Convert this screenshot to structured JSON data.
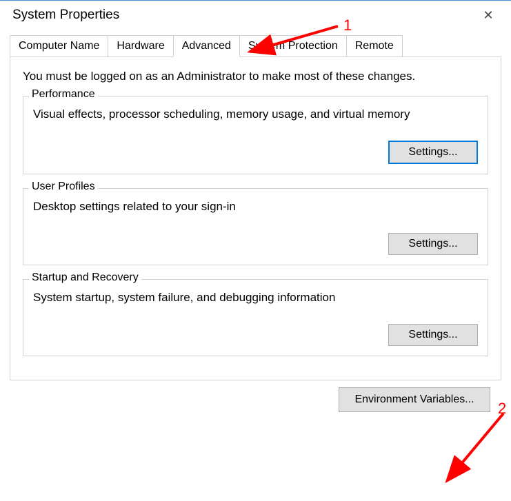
{
  "window": {
    "title": "System Properties"
  },
  "tabs": {
    "computer_name": "Computer Name",
    "hardware": "Hardware",
    "advanced": "Advanced",
    "system_protection": "System Protection",
    "remote": "Remote"
  },
  "panel": {
    "admin_message": "You must be logged on as an Administrator to make most of these changes.",
    "performance": {
      "title": "Performance",
      "desc": "Visual effects, processor scheduling, memory usage, and virtual memory",
      "button": "Settings..."
    },
    "user_profiles": {
      "title": "User Profiles",
      "desc": "Desktop settings related to your sign-in",
      "button": "Settings..."
    },
    "startup_recovery": {
      "title": "Startup and Recovery",
      "desc": "System startup, system failure, and debugging information",
      "button": "Settings..."
    },
    "env_vars_button": "Environment Variables..."
  },
  "annotations": {
    "one": "1",
    "two": "2"
  }
}
